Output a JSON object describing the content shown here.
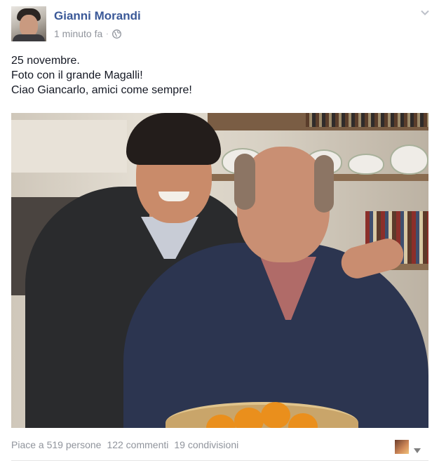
{
  "post": {
    "author": "Gianni Morandi",
    "timestamp": "1 minuto fa",
    "separator": "·",
    "privacy_icon": "globe-icon",
    "menu_icon": "chevron-down-icon",
    "text_lines": [
      "25 novembre.",
      "Foto con il grande Magalli!",
      "Ciao Giancarlo, amici come sempre!"
    ]
  },
  "footer": {
    "likes": "Piace a 519 persone",
    "comments": "122 commenti",
    "shares": "19 condivisioni",
    "actor_menu_icon": "caret-down-icon"
  },
  "colors": {
    "author": "#3b5998",
    "meta": "#90949c",
    "text": "#141823"
  }
}
